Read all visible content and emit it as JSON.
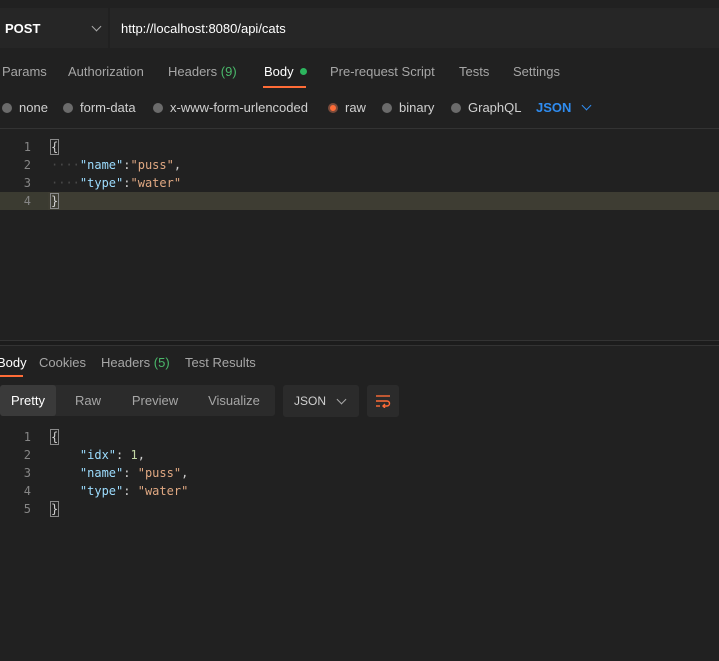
{
  "request": {
    "method": "POST",
    "url": "http://localhost:8080/api/cats"
  },
  "request_tabs": [
    {
      "label": "Params"
    },
    {
      "label": "Authorization"
    },
    {
      "label": "Headers",
      "count": "(9)"
    },
    {
      "label": "Body"
    },
    {
      "label": "Pre-request Script"
    },
    {
      "label": "Tests"
    },
    {
      "label": "Settings"
    }
  ],
  "body_types": [
    {
      "label": "none"
    },
    {
      "label": "form-data"
    },
    {
      "label": "x-www-form-urlencoded"
    },
    {
      "label": "raw",
      "selected": true
    },
    {
      "label": "binary"
    },
    {
      "label": "GraphQL"
    }
  ],
  "body_format": "JSON",
  "request_body": {
    "line_numbers": [
      "1",
      "2",
      "3",
      "4"
    ],
    "open_brace": "{",
    "close_brace": "}",
    "fields": [
      {
        "key": "\"name\"",
        "value": "\"puss\"",
        "trail": ","
      },
      {
        "key": "\"type\"",
        "value": "\"water\"",
        "trail": ""
      }
    ]
  },
  "response_tabs": [
    {
      "label": "Body"
    },
    {
      "label": "Cookies"
    },
    {
      "label": "Headers",
      "count": "(5)"
    },
    {
      "label": "Test Results"
    }
  ],
  "response_views": [
    {
      "label": "Pretty"
    },
    {
      "label": "Raw"
    },
    {
      "label": "Preview"
    },
    {
      "label": "Visualize"
    }
  ],
  "response_format": "JSON",
  "response_body": {
    "line_numbers": [
      "1",
      "2",
      "3",
      "4",
      "5"
    ],
    "open_brace": "{",
    "close_brace": "}",
    "fields": [
      {
        "key": "\"idx\"",
        "value": "1",
        "trail": ","
      },
      {
        "key": "\"name\"",
        "value": "\"puss\"",
        "trail": ","
      },
      {
        "key": "\"type\"",
        "value": "\"water\"",
        "trail": ""
      }
    ]
  },
  "colors": {
    "accent": "#ff6c37",
    "link_blue": "#2f8cf0",
    "count_green": "#4ab86a",
    "key_blue": "#9cdcfe",
    "string_orange": "#e0a882"
  }
}
